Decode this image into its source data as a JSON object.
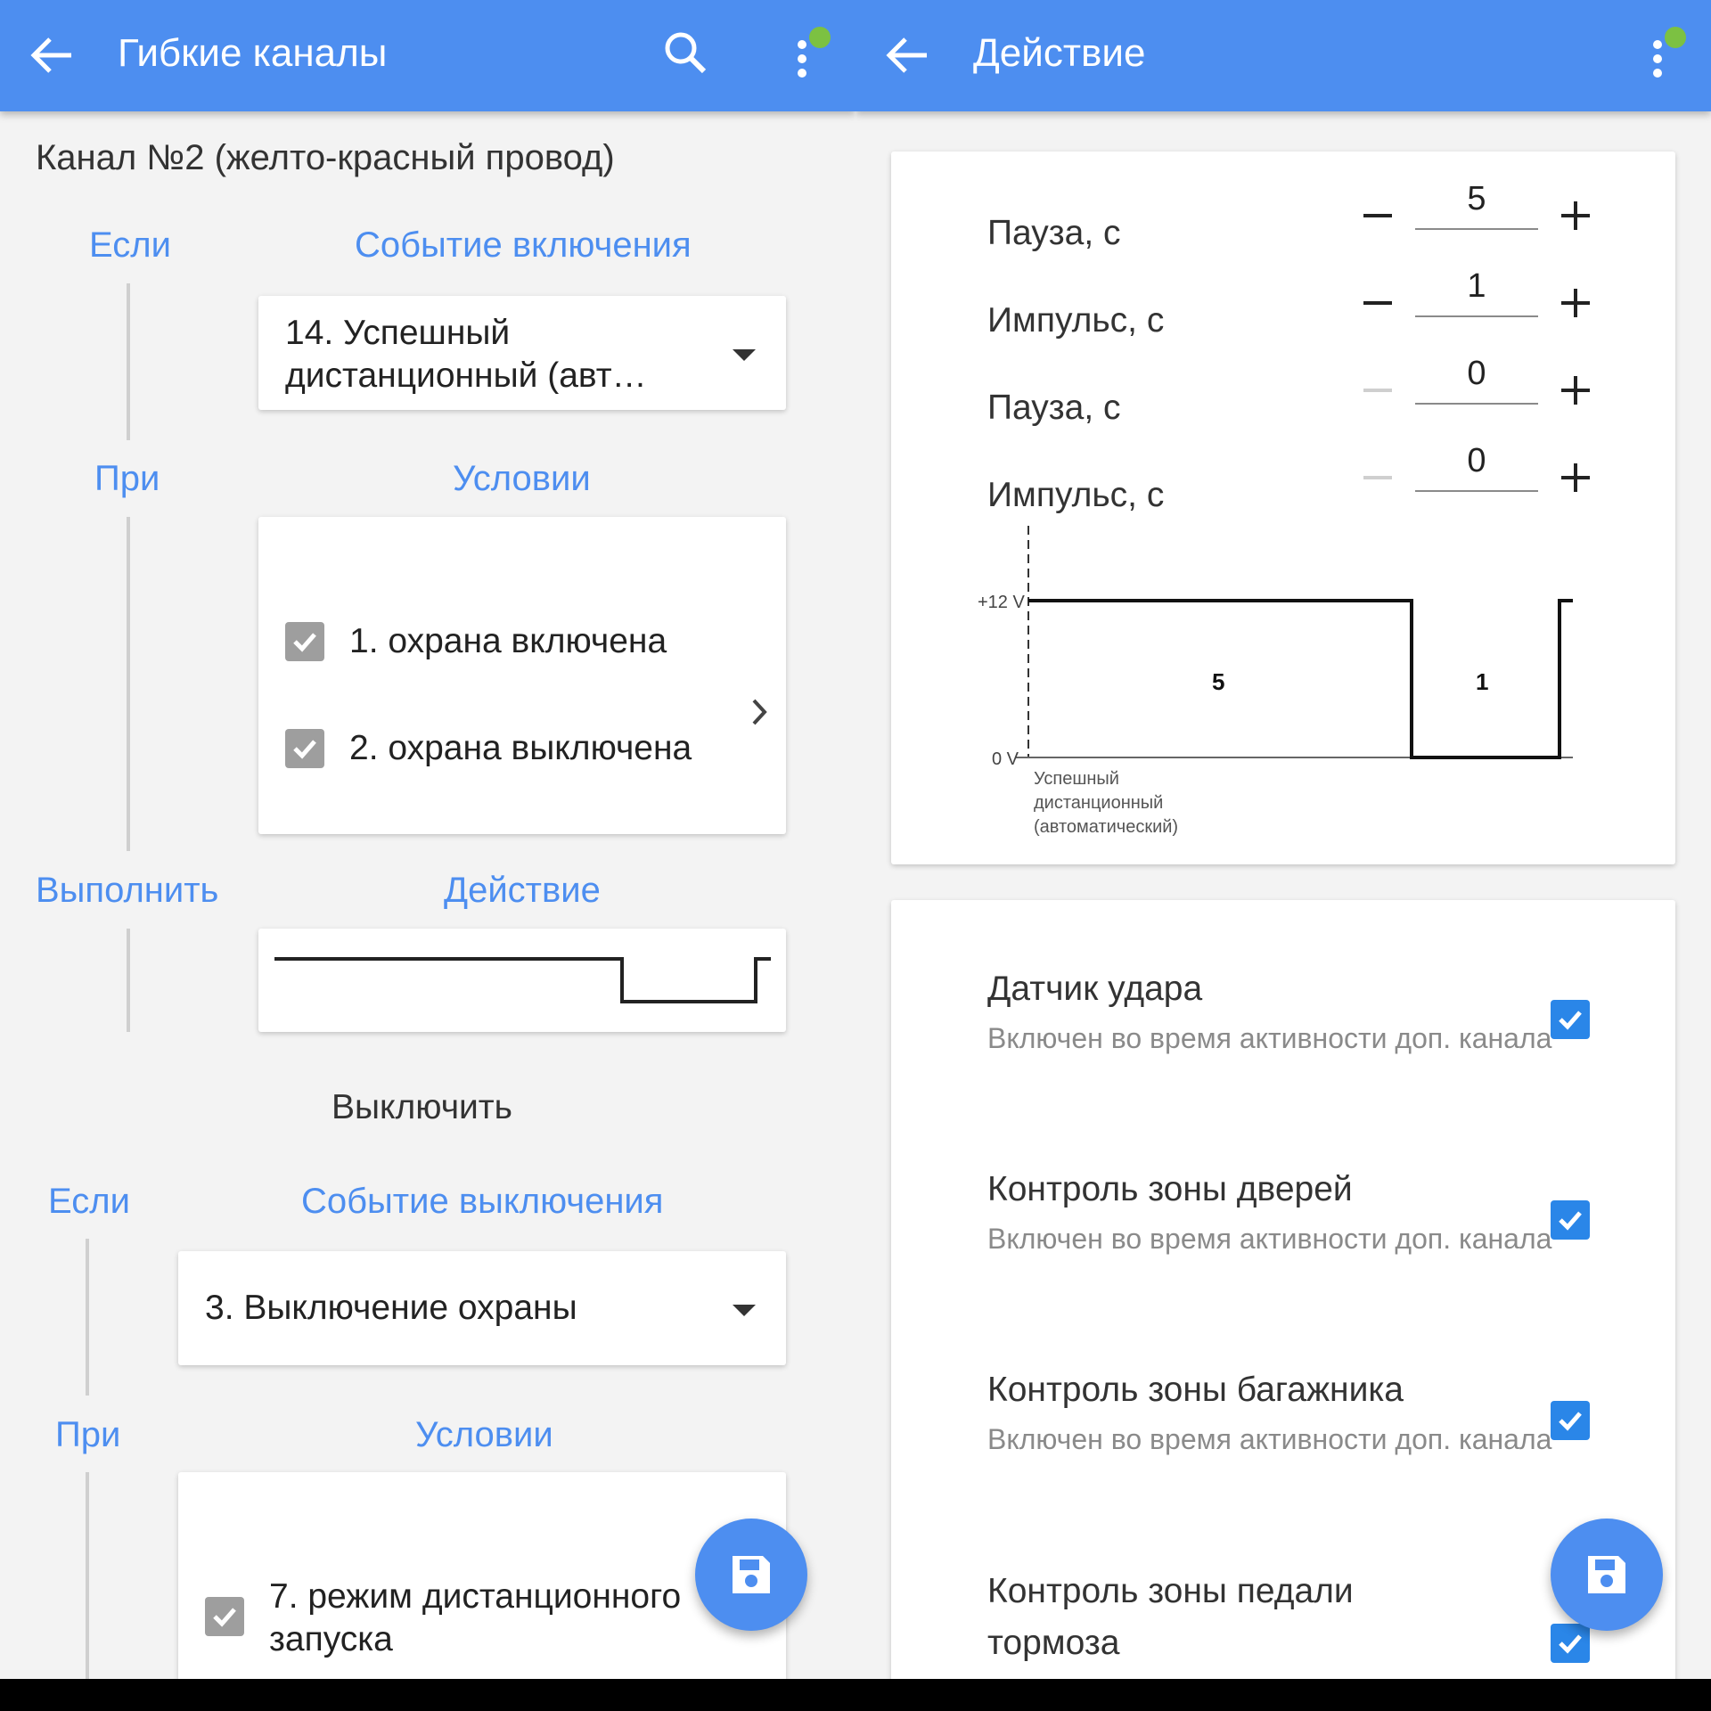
{
  "left": {
    "appbar": {
      "title": "Гибкие каналы"
    },
    "channel_title": "Канал №2 (желто-красный провод)",
    "on": {
      "if_label": "Если",
      "event_label": "Событие включения",
      "event_value": "14. Успешный дистанционный (авт…",
      "when_label": "При",
      "conditions_label": "Условии",
      "conditions": [
        "1. охрана включена",
        "2. охрана выключена"
      ],
      "exec_label": "Выполнить",
      "action_label": "Действие"
    },
    "turn_off_label": "Выключить",
    "off": {
      "if_label": "Если",
      "event_label": "Событие выключения",
      "event_value": "3. Выключение охраны",
      "when_label": "При",
      "conditions_label": "Условии",
      "conditions": [
        "7. режим дистанционного запуска"
      ]
    }
  },
  "right": {
    "appbar": {
      "title": "Действие"
    },
    "params": [
      {
        "label": "Пауза, с",
        "value": "5"
      },
      {
        "label": "Импульс, с",
        "value": "1"
      },
      {
        "label": "Пауза, с",
        "value": "0"
      },
      {
        "label": "Импульс, с",
        "value": "0"
      }
    ],
    "chart": {
      "y_high": "+12 V",
      "y_low": "0 V",
      "pause_value": "5",
      "pulse_value": "1",
      "event_caption": [
        "Успешный",
        "дистанционный",
        "(автоматический)"
      ]
    },
    "settings": [
      {
        "title": "Датчик удара",
        "subtitle": "Включен во время активности доп. канала"
      },
      {
        "title": "Контроль зоны дверей",
        "subtitle": "Включен во время активности доп. канала"
      },
      {
        "title": "Контроль зоны багажника",
        "subtitle": "Включен во время активности доп. канала"
      },
      {
        "title": "Контроль зоны педали тормоза",
        "subtitle": ""
      }
    ]
  },
  "colors": {
    "accent": "#4d8ef0",
    "checkbox_gray": "#9e9e9e",
    "checkbox_blue": "#2a86e8",
    "status_dot": "#7cc142"
  }
}
